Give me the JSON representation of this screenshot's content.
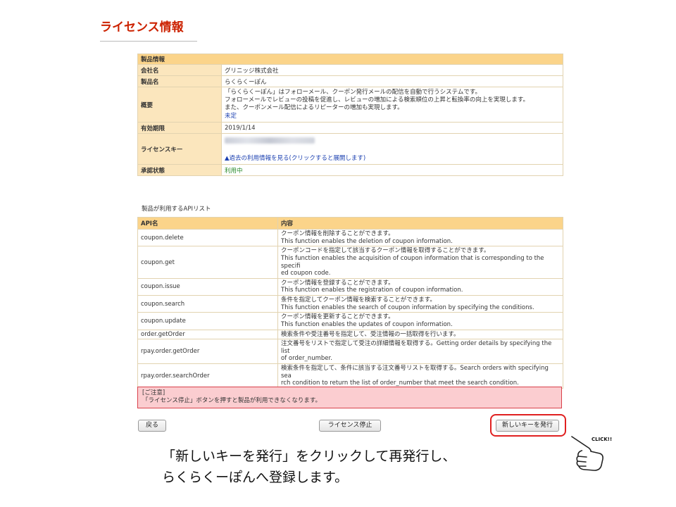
{
  "page_title": "ライセンス情報",
  "product": {
    "section_label": "製品情報",
    "rows": [
      {
        "label": "会社名",
        "value": "グリニッジ株式会社"
      },
      {
        "label": "製品名",
        "value": "らくらくーぽん"
      }
    ],
    "summary_label": "概要",
    "summary_lines": [
      "「らくらくーぽん」はフォローメール、クーポン発行メールの配信を自動で行うシステムです。",
      "フォローメールでレビューの投稿を促進し、レビューの増加による検索順位の上昇と転換率の向上を実現します。",
      "また、クーポンメール配信によるリピーターの増加も実現します。"
    ],
    "summary_status": "未定",
    "expiry_label": "有効期限",
    "expiry_value": "2019/1/14",
    "license_key_label": "ライセンスキー",
    "usage_history_link": "▲過去の利用情報を見る(クリックすると展開します)",
    "approval_label": "承認状態",
    "approval_value": "利用中"
  },
  "api_list": {
    "caption": "製品が利用するAPIリスト",
    "col_name": "API名",
    "col_content": "内容",
    "rows": [
      {
        "name": "coupon.delete",
        "desc": [
          "クーポン情報を削除することができます。",
          "This function enables the deletion of coupon information."
        ]
      },
      {
        "name": "coupon.get",
        "desc": [
          "クーポンコードを指定して該当するクーポン情報を取得することができます。",
          "This function enables the acquisition of coupon information that is corresponding to the specifi",
          "ed coupon code."
        ]
      },
      {
        "name": "coupon.issue",
        "desc": [
          "クーポン情報を登録することができます。",
          "This function enables the registration of coupon information."
        ]
      },
      {
        "name": "coupon.search",
        "desc": [
          "条件を指定してクーポン情報を検索することができます。",
          "This function enables the search of coupon information by specifying the conditions."
        ]
      },
      {
        "name": "coupon.update",
        "desc": [
          "クーポン情報を更新することができます。",
          "This function enables the updates of coupon information."
        ]
      },
      {
        "name": "order.getOrder",
        "desc": [
          "検索条件や受注番号を指定して、受注情報の一括取得を行います。"
        ]
      },
      {
        "name": "rpay.order.getOrder",
        "desc": [
          "注文番号をリストで指定して受注の詳細情報を取得する。Getting order details by specifying the list",
          "of order_number."
        ]
      },
      {
        "name": "rpay.order.searchOrder",
        "desc": [
          "検索条件を指定して、条件に該当する注文番号リストを取得する。Search orders with specifying sea",
          "rch condition to return the list of order_number that meet the search condition."
        ]
      }
    ]
  },
  "warning": {
    "title": "[ご注意]",
    "text": "「ライセンス停止」ボタンを押すと製品が利用できなくなります。"
  },
  "buttons": {
    "back": "戻る",
    "stop_license": "ライセンス停止",
    "new_key": "新しいキーを発行"
  },
  "click_badge": "CLICK!!",
  "caption": {
    "line1": "「新しいキーを発行」をクリックして再発行し、",
    "line2": "らくらくーぽんへ登録します。"
  },
  "colors": {
    "title": "#cc2200",
    "table_header": "#fbd48a",
    "table_label": "#fbe6bd",
    "warning_bg": "#fbcdd0",
    "highlight": "#e02020"
  }
}
